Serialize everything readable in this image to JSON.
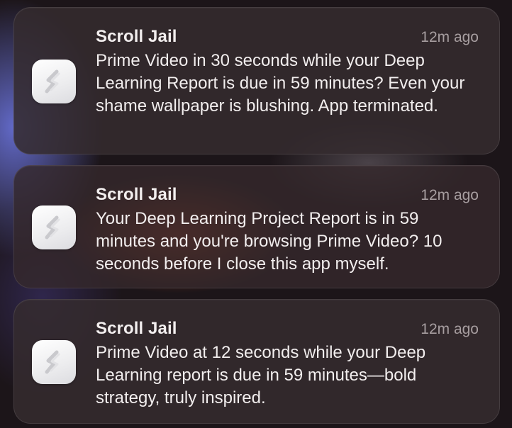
{
  "notifications": [
    {
      "app_name": "Scroll Jail",
      "time": "12m ago",
      "icon": "scroll-jail-app-icon",
      "message": "Prime Video in 30 seconds while your Deep Learning Report is due in 59 minutes? Even your shame wallpaper is blushing. App terminated."
    },
    {
      "app_name": "Scroll Jail",
      "time": "12m ago",
      "icon": "scroll-jail-app-icon",
      "message": "Your Deep Learning Project Report is in 59 minutes and you're browsing Prime Video? 10 seconds before I close this app myself."
    },
    {
      "app_name": "Scroll Jail",
      "time": "12m ago",
      "icon": "scroll-jail-app-icon",
      "message": "Prime Video at 12 seconds while your Deep Learning report is due in 59 minutes—bold strategy, truly inspired."
    }
  ]
}
